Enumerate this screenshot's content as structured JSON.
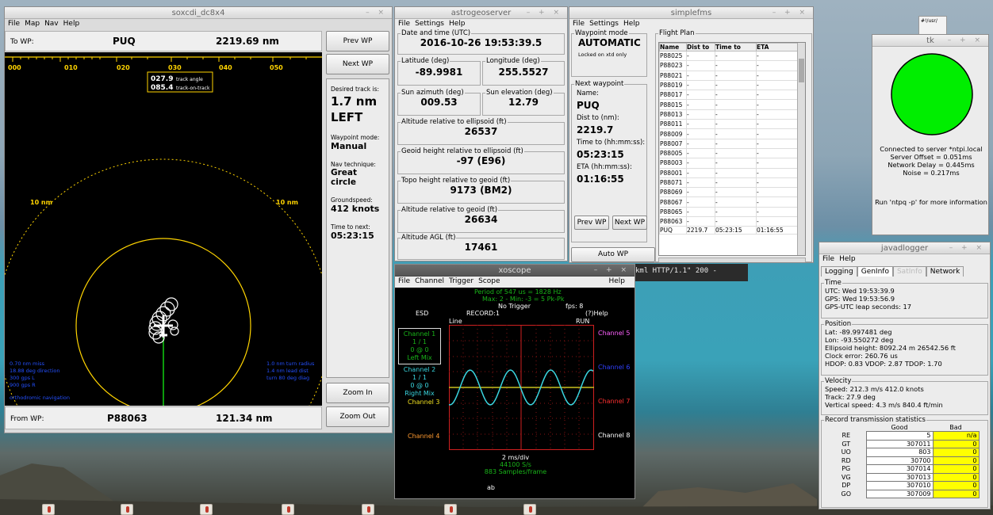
{
  "soxcdi": {
    "title": "soxcdi_dc8x4",
    "menu": [
      "File",
      "Map",
      "Nav",
      "Help"
    ],
    "to_label": "To WP:",
    "to_wp": "PUQ",
    "to_dist": "2219.69 nm",
    "from_label": "From WP:",
    "from_wp": "P88063",
    "from_dist": "121.34 nm",
    "compass": [
      "000",
      "010",
      "020",
      "030",
      "040",
      "050"
    ],
    "track_angle": "027.9",
    "track_angle_label": "track angle",
    "track_on_track": "085.4",
    "track_on_track_label": "track-on-track",
    "ring_label": "10 nm",
    "prev_wp": "Prev WP",
    "next_wp": "Next WP",
    "zoom_in": "Zoom In",
    "zoom_out": "Zoom Out",
    "desired_label": "Desired track is:",
    "desired_dist": "1.7 nm",
    "desired_dir": "LEFT",
    "wp_mode_label": "Waypoint mode:",
    "wp_mode": "Manual",
    "nav_label": "Nav technique:",
    "nav": "Great circle",
    "gs_label": "Groundspeed:",
    "gs": "412 knots",
    "ttn_label": "Time to next:",
    "ttn": "05:23:15",
    "left_info": [
      "0.70 nm miss",
      "18.88 deg direction",
      "300 gps L",
      "900 gps R",
      "orthodromic navigation"
    ],
    "right_info": [
      "1.0 nm turn radius",
      "1.4 nm lead dist",
      "turn 80 deg diag"
    ]
  },
  "astro": {
    "title": "astrogeoserver",
    "menu": [
      "File",
      "Settings",
      "Help"
    ],
    "dt_label": "Date and time (UTC)",
    "dt": "2016-10-26   19:53:39.5",
    "lat_label": "Latitude (deg)",
    "lat": "-89.9981",
    "lon_label": "Longitude (deg)",
    "lon": "255.5527",
    "saz_label": "Sun azimuth (deg)",
    "saz": "009.53",
    "sel_label": "Sun elevation (deg)",
    "sel": "12.79",
    "alt_ell_label": "Altitude relative to ellipsoid (ft)",
    "alt_ell": "26537",
    "geoid_label": "Geoid height relative to ellipsoid (ft)",
    "geoid": "-97 (E96)",
    "topo_label": "Topo height relative to geoid (ft)",
    "topo": "9173 (BM2)",
    "alt_geoid_label": "Altitude relative to geoid (ft)",
    "alt_geoid": "26634",
    "agl_label": "Altitude AGL (ft)",
    "agl": "17461"
  },
  "fms": {
    "title": "simplefms",
    "menu": [
      "File",
      "Settings",
      "Help"
    ],
    "mode_label": "Waypoint mode",
    "mode": "AUTOMATIC",
    "mode_note": "Locked on xtd only",
    "next_label": "Next waypoint",
    "name_label": "Name:",
    "name": "PUQ",
    "dist_label": "Dist to (nm):",
    "dist": "2219.7",
    "time_label": "Time to (hh:mm:ss):",
    "time": "05:23:15",
    "eta_label": "ETA (hh:mm:ss):",
    "eta": "01:16:55",
    "prev": "Prev WP",
    "next": "Next WP",
    "auto": "Auto WP",
    "plan_label": "Flight Plan",
    "cols": [
      "Name",
      "Dist to",
      "Time to",
      "ETA"
    ],
    "rows": [
      "P88025",
      "P88023",
      "P88021",
      "P88019",
      "P88017",
      "P88015",
      "P88013",
      "P88011",
      "P88009",
      "P88007",
      "P88005",
      "P88003",
      "P88001",
      "P88071",
      "P88069",
      "P88067",
      "P88065",
      "P88063"
    ],
    "dash": "-",
    "last": {
      "name": "PUQ",
      "dist": "2219.7",
      "time": "05:23:15",
      "eta": "01:16:55"
    }
  },
  "terminal_text": "kml HTTP/1.1\" 200 -",
  "xoscope": {
    "title": "xoscope",
    "menu": [
      "File",
      "Channel",
      "Trigger",
      "Scope"
    ],
    "help": "Help",
    "period": "Period of   547 us =   1828 Hz",
    "maxmin": "Max:  2 - Min:  -3  =  5 Pk-Pk",
    "trigger": "No Trigger",
    "fps": "fps:  8",
    "esd": "ESD",
    "record": "RECORD:1",
    "qhelp": "(?)Help",
    "line": "Line",
    "run": "RUN",
    "ch1": [
      "Channel 1",
      "1 / 1",
      "0 @ 0",
      "Left Mix"
    ],
    "ch2": [
      "Channel 2",
      "1 / 1",
      "0 @ 0",
      "Right Mix"
    ],
    "ch3": "Channel 3",
    "ch4": "Channel 4",
    "ch5": "Channel 5",
    "ch6": "Channel 6",
    "ch7": "Channel 7",
    "ch8": "Channel 8",
    "div": "2 ms/div",
    "rate": "44100 S/s",
    "samples": "883 Samples/frame",
    "ab": "ab"
  },
  "tk": {
    "title": "tk",
    "status": "#00ee00",
    "lines": [
      "Connected to server *ntpi.local",
      "Server Offset = 0.051ms",
      "Network Delay = 0.445ms",
      "Noise = 0.217ms"
    ],
    "hint": "Run 'ntpq -p' for more information"
  },
  "javad": {
    "title": "javadlogger",
    "menu": [
      "File",
      "Help"
    ],
    "tabs": [
      "Logging",
      "GenInfo",
      "SatInfo",
      "Network"
    ],
    "time_label": "Time",
    "utc": "UTC: Wed 19:53:39.9",
    "gps": "GPS: Wed 19:53:56.9",
    "leap": "GPS-UTC leap seconds: 17",
    "pos_label": "Position",
    "lat": "Lat: -89.997481 deg",
    "lon": "Lon: -93.550272 deg",
    "ellh": "Ellipsoid height: 8092.24 m   26542.56 ft",
    "clock": "Clock error: 260.76 us",
    "dop": "HDOP:  0.83  VDOP:  2.87  TDOP:  1.70",
    "vel_label": "Velocity",
    "speed": "Speed: 212.3 m/s   412.0 knots",
    "track": "Track:  27.9 deg",
    "vspeed": "Vertical speed:   4.3 m/s     840.4 ft/min",
    "rec_label": "Record transmission statistics",
    "good": "Good",
    "bad": "Bad",
    "rows": [
      [
        "RE",
        "5",
        "n/a"
      ],
      [
        "GT",
        "307011",
        "0"
      ],
      [
        "UO",
        "803",
        "0"
      ],
      [
        "RD",
        "30700",
        "0"
      ],
      [
        "PG",
        "307014",
        "0"
      ],
      [
        "VG",
        "307013",
        "0"
      ],
      [
        "DP",
        "307010",
        "0"
      ],
      [
        "GO",
        "307009",
        "0"
      ]
    ]
  },
  "desktop_icon": "#!/usr/"
}
